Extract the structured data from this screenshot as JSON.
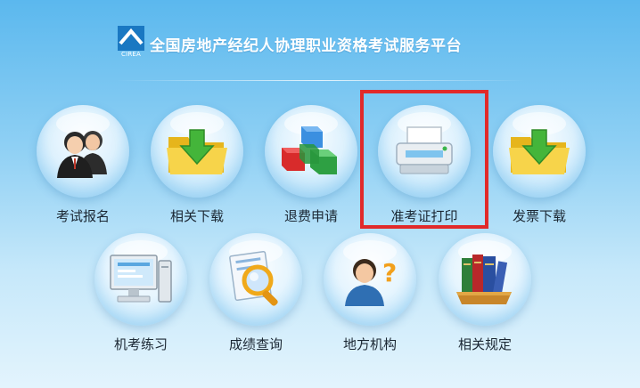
{
  "header": {
    "logo_caption": "CIREA",
    "title": "全国房地产经纪人协理职业资格考试服务平台"
  },
  "row1": [
    {
      "label": "考试报名",
      "icon": "users-icon"
    },
    {
      "label": "相关下载",
      "icon": "folder-download-icon"
    },
    {
      "label": "退费申请",
      "icon": "cubes-icon"
    },
    {
      "label": "准考证打印",
      "icon": "printer-icon"
    },
    {
      "label": "发票下载",
      "icon": "folder-download-icon"
    }
  ],
  "row2": [
    {
      "label": "机考练习",
      "icon": "computer-icon"
    },
    {
      "label": "成绩查询",
      "icon": "magnifier-document-icon"
    },
    {
      "label": "地方机构",
      "icon": "person-question-icon"
    },
    {
      "label": "相关规定",
      "icon": "books-icon"
    }
  ],
  "highlight": {
    "color": "#e12a2a",
    "target": "准考证打印"
  },
  "colors": {
    "background_top": "#5bb8ee",
    "background_bottom": "#e3f4fd",
    "title": "#ffffff"
  }
}
